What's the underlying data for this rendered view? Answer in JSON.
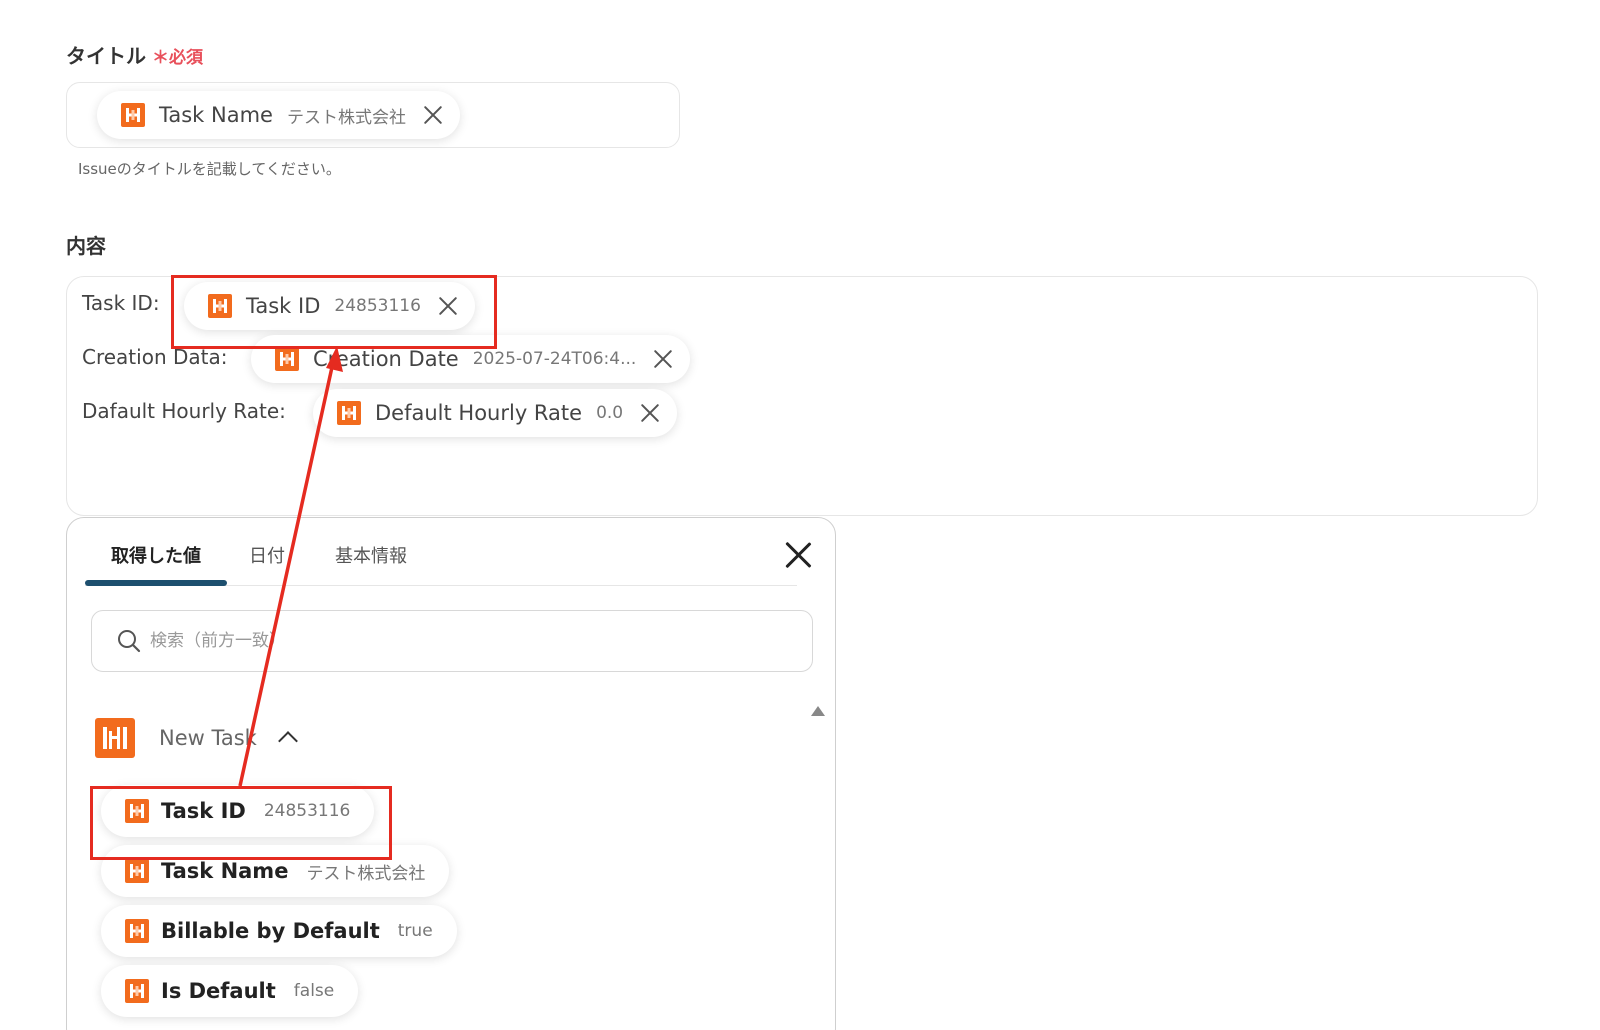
{
  "title_section": {
    "label": "タイトル",
    "required_mark": "＊必須",
    "chip": {
      "name": "Task Name",
      "value": "テスト株式会社"
    },
    "hint": "Issueのタイトルを記載してください。"
  },
  "content_section": {
    "label": "内容",
    "lines": [
      {
        "label": "Task ID:",
        "chip_name": "Task ID",
        "chip_value": "24853116"
      },
      {
        "label": "Creation Data:",
        "chip_name": "Creation Date",
        "chip_value": "2025-07-24T06:4..."
      },
      {
        "label": "Dafault Hourly Rate:",
        "chip_name": "Default Hourly Rate",
        "chip_value": "0.0"
      }
    ]
  },
  "popup": {
    "tabs": [
      {
        "label": "取得した値",
        "active": true
      },
      {
        "label": "日付",
        "active": false
      },
      {
        "label": "基本情報",
        "active": false
      }
    ],
    "search_placeholder": "検索（前方一致）",
    "group": {
      "title": "New Task",
      "items": [
        {
          "name": "Task ID",
          "value": "24853116"
        },
        {
          "name": "Task Name",
          "value": "テスト株式会社"
        },
        {
          "name": "Billable by Default",
          "value": "true"
        },
        {
          "name": "Is Default",
          "value": "false"
        }
      ]
    }
  },
  "colors": {
    "brand_orange": "#f26b1d",
    "highlight_red": "#e52b20",
    "required_red": "#e8505b",
    "tab_underline": "#1d4f6e"
  },
  "icons": {
    "app": "harvest-app-icon",
    "close": "close-icon",
    "search": "search-icon",
    "collapse": "chevron-up-icon"
  }
}
